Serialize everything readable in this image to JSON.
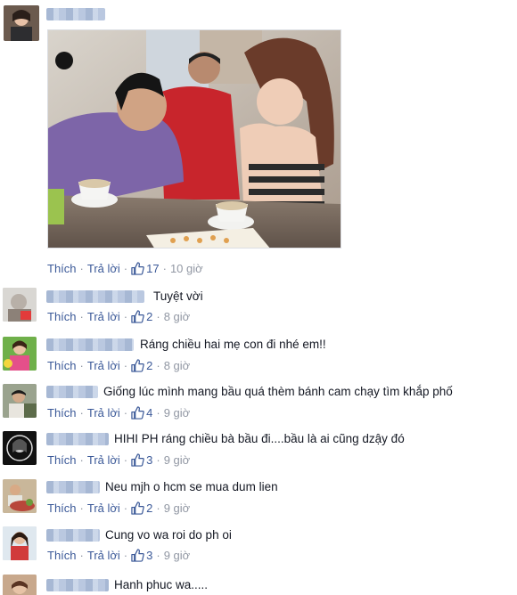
{
  "post": {
    "like_label": "Thích",
    "reply_label": "Trả lời",
    "likes": "17",
    "time": "10 giờ"
  },
  "colors": {
    "link": "#3b5998",
    "meta": "#9197a3",
    "text": "#141823"
  },
  "comments": [
    {
      "text": "Tuyệt vời",
      "likes": "2",
      "time": "8 giờ"
    },
    {
      "text": "Ráng chiều hai mẹ con đi nhé em!!",
      "likes": "2",
      "time": "8 giờ"
    },
    {
      "text": "Giống lúc mình mang bầu quá thèm bánh cam chạy tìm khắp phố",
      "likes": "4",
      "time": "9 giờ"
    },
    {
      "text": "HIHI PH ráng chiều bà bầu đi....bầu là ai cũng dzậy đó",
      "likes": "3",
      "time": "9 giờ"
    },
    {
      "text": "Neu mjh o hcm se mua dum lien",
      "likes": "2",
      "time": "9 giờ"
    },
    {
      "text": "Cung vo wa roi do ph oi",
      "likes": "3",
      "time": "9 giờ"
    },
    {
      "text": "Hanh phuc wa....."
    }
  ]
}
